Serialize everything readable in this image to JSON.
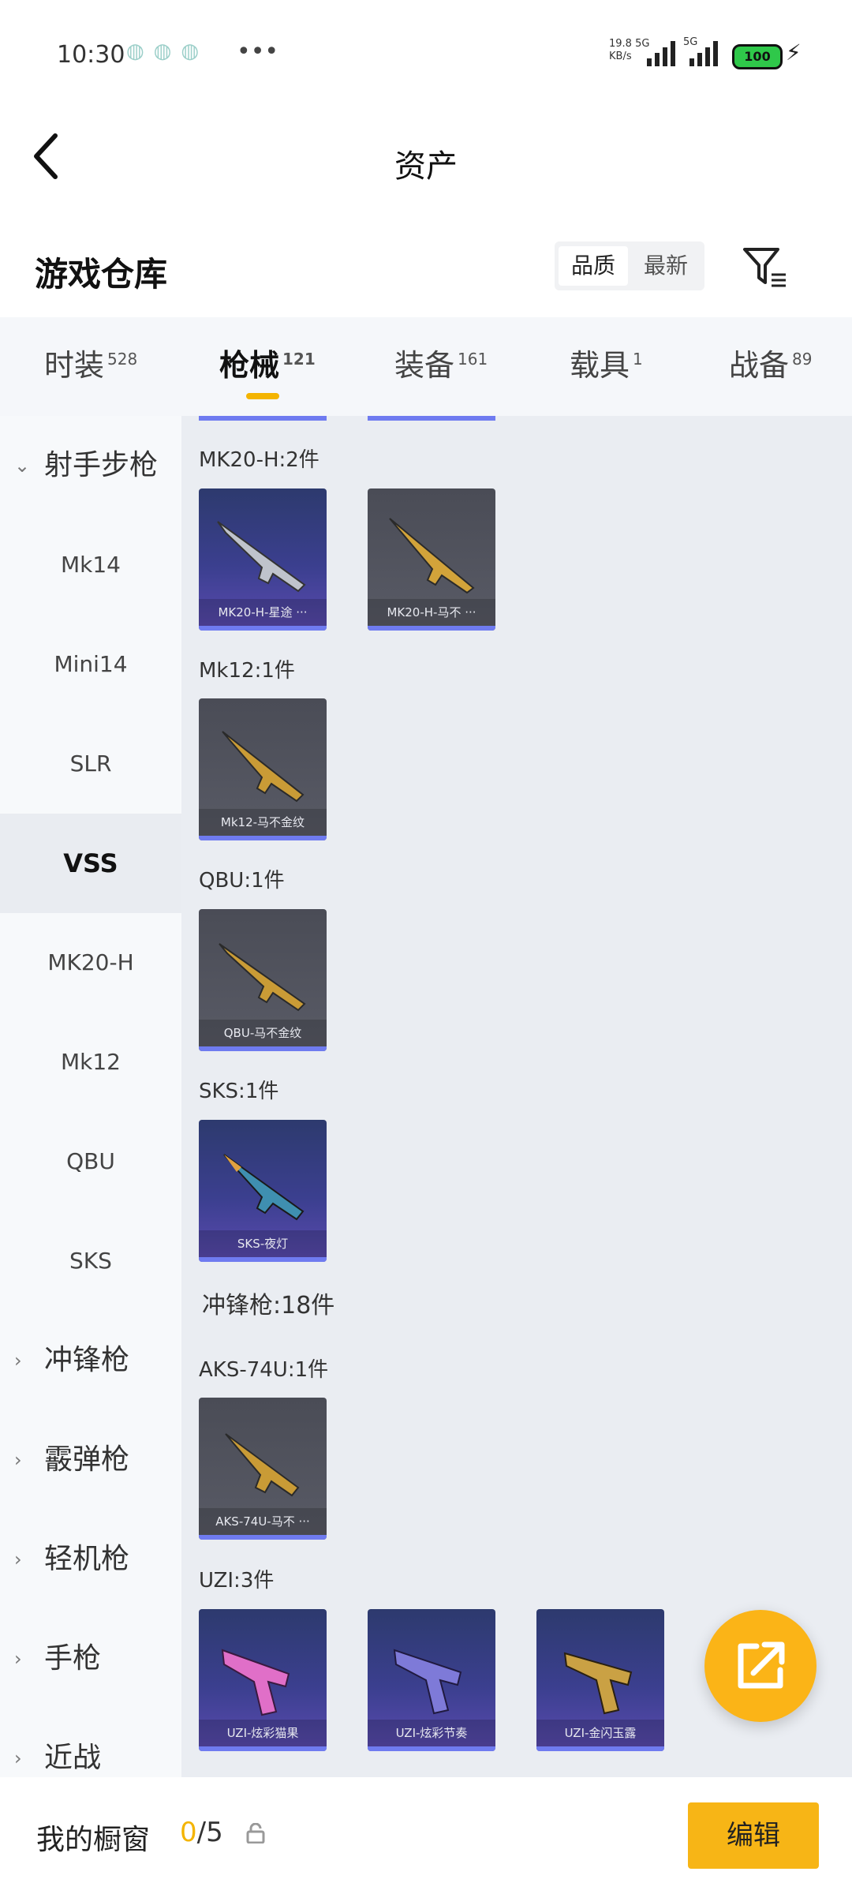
{
  "status": {
    "time": "10:30",
    "more": "•••",
    "net_speed": "19.8",
    "net_unit": "KB/s",
    "net_type1": "5G",
    "net_type2": "5G",
    "battery": "100"
  },
  "header": {
    "title": "资产"
  },
  "section": {
    "title": "游戏仓库",
    "sort_quality": "品质",
    "sort_latest": "最新"
  },
  "tabs": [
    {
      "label": "时装",
      "count": "528"
    },
    {
      "label": "枪械",
      "count": "121"
    },
    {
      "label": "装备",
      "count": "161"
    },
    {
      "label": "载具",
      "count": "1"
    },
    {
      "label": "战备",
      "count": "89"
    }
  ],
  "sidebar": {
    "items": [
      {
        "label": "射手步枪",
        "type": "category",
        "expanded": true
      },
      {
        "label": "Mk14"
      },
      {
        "label": "Mini14"
      },
      {
        "label": "SLR"
      },
      {
        "label": "VSS",
        "active": true
      },
      {
        "label": "MK20-H"
      },
      {
        "label": "Mk12"
      },
      {
        "label": "QBU"
      },
      {
        "label": "SKS"
      },
      {
        "label": "冲锋枪",
        "type": "category"
      },
      {
        "label": "霰弹枪",
        "type": "category"
      },
      {
        "label": "轻机枪",
        "type": "category"
      },
      {
        "label": "手枪",
        "type": "category"
      },
      {
        "label": "近战",
        "type": "category"
      }
    ]
  },
  "groups": [
    {
      "label": "MK20-H:2件",
      "items": [
        {
          "name": "MK20-H-星途 ···"
        },
        {
          "name": "MK20-H-马不 ···"
        }
      ]
    },
    {
      "label": "Mk12:1件",
      "items": [
        {
          "name": "Mk12-马不金纹"
        }
      ]
    },
    {
      "label": "QBU:1件",
      "items": [
        {
          "name": "QBU-马不金纹"
        }
      ]
    },
    {
      "label": "SKS:1件",
      "items": [
        {
          "name": "SKS-夜灯"
        }
      ]
    },
    {
      "label": "冲锋枪:18件"
    },
    {
      "label": "AKS-74U:1件",
      "items": [
        {
          "name": "AKS-74U-马不 ···"
        }
      ]
    },
    {
      "label": "UZI:3件",
      "items": [
        {
          "name": "UZI-炫彩猫果"
        },
        {
          "name": "UZI-炫彩节奏"
        },
        {
          "name": "UZI-金闪玉露"
        }
      ]
    }
  ],
  "bottom": {
    "label": "我的橱窗",
    "count_used": "0",
    "count_total": "/5",
    "edit_label": "编辑"
  },
  "colors": {
    "accent": "#f4b400",
    "rarity_purple": "#6f7bf0"
  }
}
